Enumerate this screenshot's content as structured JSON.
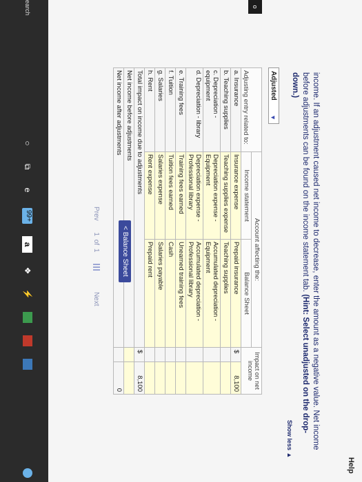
{
  "help_label": "Help",
  "instruction_lead": "income. If an adjustment caused net income to decrease, enter the amount as a negative value. Net income before adjustments can be found on the income statement tab.",
  "instruction_hint": "(Hint: Select unadjusted on the drop-down.)",
  "show_less": "Show less ▲",
  "dropdown": {
    "value": "Adjusted",
    "caret": "▼"
  },
  "table": {
    "col_adjusting_entry": "Adjusting entry related to:",
    "col_account_affecting": "Account affecting the:",
    "col_income_statement": "Income statement",
    "col_balance_sheet": "Balance Sheet",
    "col_impact": "Impact on net income",
    "rows": [
      {
        "entry": "a. Insurance",
        "income": "Insurance expense",
        "balance": "Prepaid insurance",
        "currency": "$",
        "impact": "8,100"
      },
      {
        "entry": "b. Teaching supplies",
        "income": "Teaching supplies expense",
        "balance": "Teaching supplies",
        "currency": "",
        "impact": ""
      },
      {
        "entry": "c. Depreciation - equipment",
        "income": "Depreciation expense - Equipment",
        "balance": "Accumulated depreciation - Equipment",
        "currency": "",
        "impact": ""
      },
      {
        "entry": "d. Depreciation - library",
        "income": "Depreciation expense - Professional library",
        "balance": "Accumulated depreciation - Professional library",
        "currency": "",
        "impact": ""
      },
      {
        "entry": "e. Training fees",
        "income": "Training fees earned",
        "balance": "Unearned training fees",
        "currency": "",
        "impact": ""
      },
      {
        "entry": "f. Tuition",
        "income": "Tuition fees earned",
        "balance": "Cash",
        "currency": "",
        "impact": ""
      },
      {
        "entry": "g. Salaries",
        "income": "Salaries expense",
        "balance": "Salaries payable",
        "currency": "",
        "impact": ""
      },
      {
        "entry": "h. Rent",
        "income": "Rent expense",
        "balance": "Prepaid rent",
        "currency": "",
        "impact": ""
      }
    ],
    "total_label": "Total impact on income due to adjustments",
    "total_currency": "$",
    "total_value": "8,100",
    "before_label": "Net income before adjustments",
    "after_label": "Net income after adjustments",
    "after_value": "0"
  },
  "nav": {
    "balance_sheet": "< Balance Sheet"
  },
  "pager": {
    "prev": "Prev",
    "current": "1",
    "of": "of",
    "total": "1",
    "next": "Next"
  },
  "taskbar": {
    "search": "earch",
    "badge": "99+",
    "a": "a"
  }
}
